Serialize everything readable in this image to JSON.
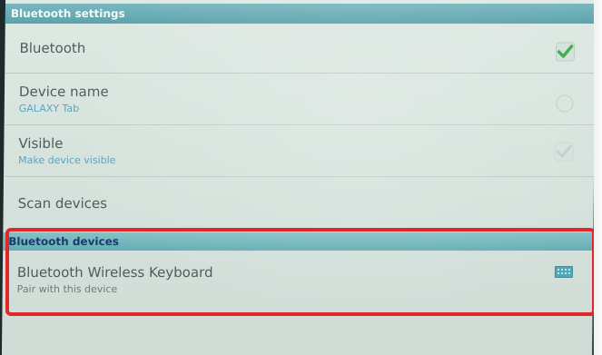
{
  "header": {
    "title": "Bluetooth settings"
  },
  "settings": [
    {
      "title": "Bluetooth",
      "subtitle": "",
      "checked": true
    },
    {
      "title": "Device name",
      "subtitle": "GALAXY Tab"
    },
    {
      "title": "Visible",
      "subtitle": "Make device visible",
      "checked": false
    },
    {
      "title": "Scan devices",
      "subtitle": ""
    }
  ],
  "devices_section": {
    "title": "Bluetooth devices",
    "devices": [
      {
        "name": "Bluetooth Wireless Keyboard",
        "status": "Pair with this device",
        "icon": "keyboard-icon"
      }
    ]
  },
  "colors": {
    "accent": "#5aa3ad",
    "highlight": "#e0282b",
    "check_on": "#3cae4a",
    "subtitle": "#5aa3c4"
  }
}
